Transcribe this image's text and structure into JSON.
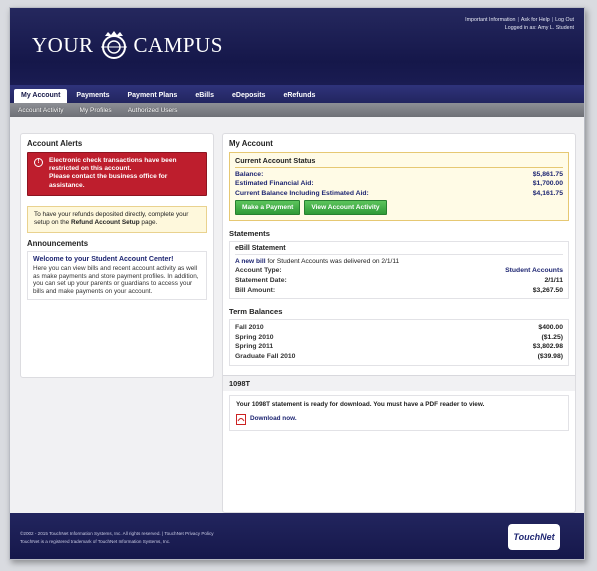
{
  "brand": {
    "left": "YOUR",
    "right": "CAMPUS"
  },
  "toplinks": {
    "items": [
      "Important Information",
      "Ask for Help",
      "Log Out"
    ],
    "logged_in": "Logged in as: Amy L. Student"
  },
  "main_nav": [
    "My Account",
    "Payments",
    "Payment Plans",
    "eBills",
    "eDeposits",
    "eRefunds"
  ],
  "sub_nav": [
    "Account Activity",
    "My Profiles",
    "Authorized Users"
  ],
  "alerts": {
    "title": "Account Alerts",
    "icon": "!",
    "message": "Electronic check transactions have been restricted on this account.",
    "contact": "Please contact the business office for assistance."
  },
  "refund_note": {
    "text": "To have your refunds deposited directly, complete your setup on the",
    "link": "Refund Account Setup",
    "suffix": "page."
  },
  "announcements": {
    "title": "Announcements",
    "heading": "Welcome to your Student Account Center!",
    "body": "Here you can view bills and recent account activity as well as make payments and store payment profiles. In addition, you can set up your parents or guardians to access your bills and make payments on your account."
  },
  "my_account": {
    "title": "My Account",
    "status": {
      "title": "Current Account Status",
      "rows": [
        {
          "label": "Balance:",
          "value": "$5,861.75"
        },
        {
          "label": "Estimated Financial Aid:",
          "value": "$1,700.00"
        },
        {
          "label": "Current Balance Including Estimated Aid:",
          "value": "$4,161.75"
        }
      ],
      "buttons": [
        "Make a Payment",
        "View Account Activity"
      ]
    }
  },
  "statements": {
    "title": "Statements",
    "box_title": "eBill Statement",
    "new_bill_link": "A new bill",
    "new_bill_text": "for Student Accounts was delivered on 2/1/11",
    "rows": [
      {
        "label": "Account Type:",
        "value": "Student Accounts"
      },
      {
        "label": "Statement Date:",
        "value": "2/1/11"
      },
      {
        "label": "Bill Amount:",
        "value": "$3,267.50"
      }
    ]
  },
  "term_balances": {
    "title": "Term Balances",
    "rows": [
      {
        "label": "Fall 2010",
        "value": "$400.00"
      },
      {
        "label": "Spring 2010",
        "value": "($1.25)"
      },
      {
        "label": "Spring 2011",
        "value": "$3,802.98"
      },
      {
        "label": "Graduate Fall 2010",
        "value": "($39.98)"
      }
    ]
  },
  "form1098": {
    "title": "1098T",
    "message": "Your 1098T statement is ready for download. You must have a PDF reader to view.",
    "download": "Download now."
  },
  "footer": {
    "line1": "©2002 - 2015 TouchNet Information Systems, Inc. All rights reserved. | TouchNet Privacy Policy",
    "line2": "TouchNet is a registered trademark of TouchNet Information Systems, Inc.",
    "badge": "TouchNet"
  },
  "colors": {
    "header": "#15174a",
    "alert": "#be1e2d",
    "button": "#3aa640",
    "link": "#1e2672"
  }
}
